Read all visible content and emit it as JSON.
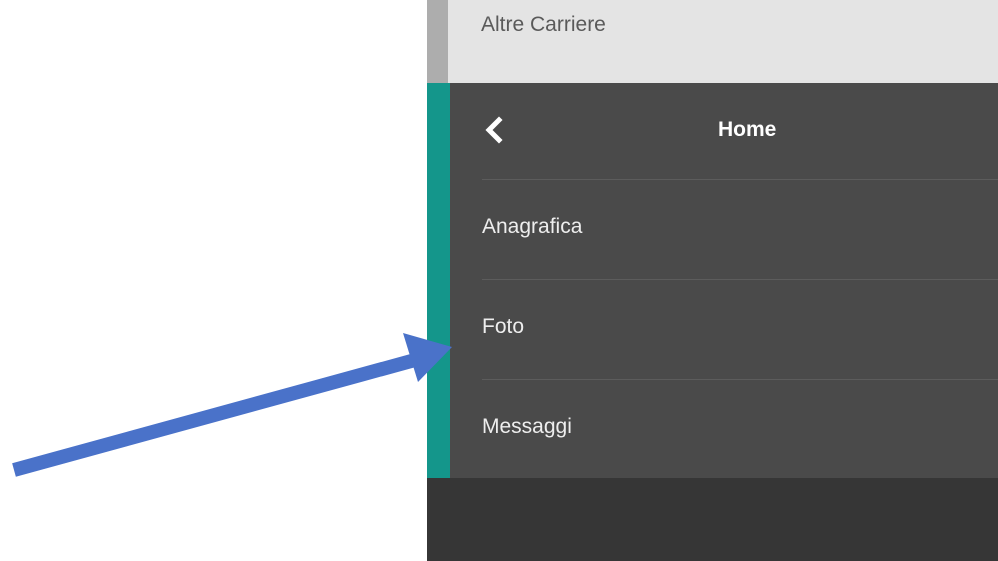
{
  "nav": {
    "top_item": "Altre Carriere",
    "header_title": "Home",
    "back_icon": "chevron-left-icon",
    "items": [
      {
        "label": "Anagrafica"
      },
      {
        "label": "Foto"
      },
      {
        "label": "Messaggi"
      }
    ]
  },
  "annotation": {
    "arrow_icon": "pointer-arrow",
    "arrow_color": "#4a72c9",
    "target": "Foto"
  },
  "colors": {
    "accent": "#14968b",
    "menu_bg": "#4a4a4a",
    "top_bg": "#e4e4e4",
    "footer_bg": "#363636"
  }
}
